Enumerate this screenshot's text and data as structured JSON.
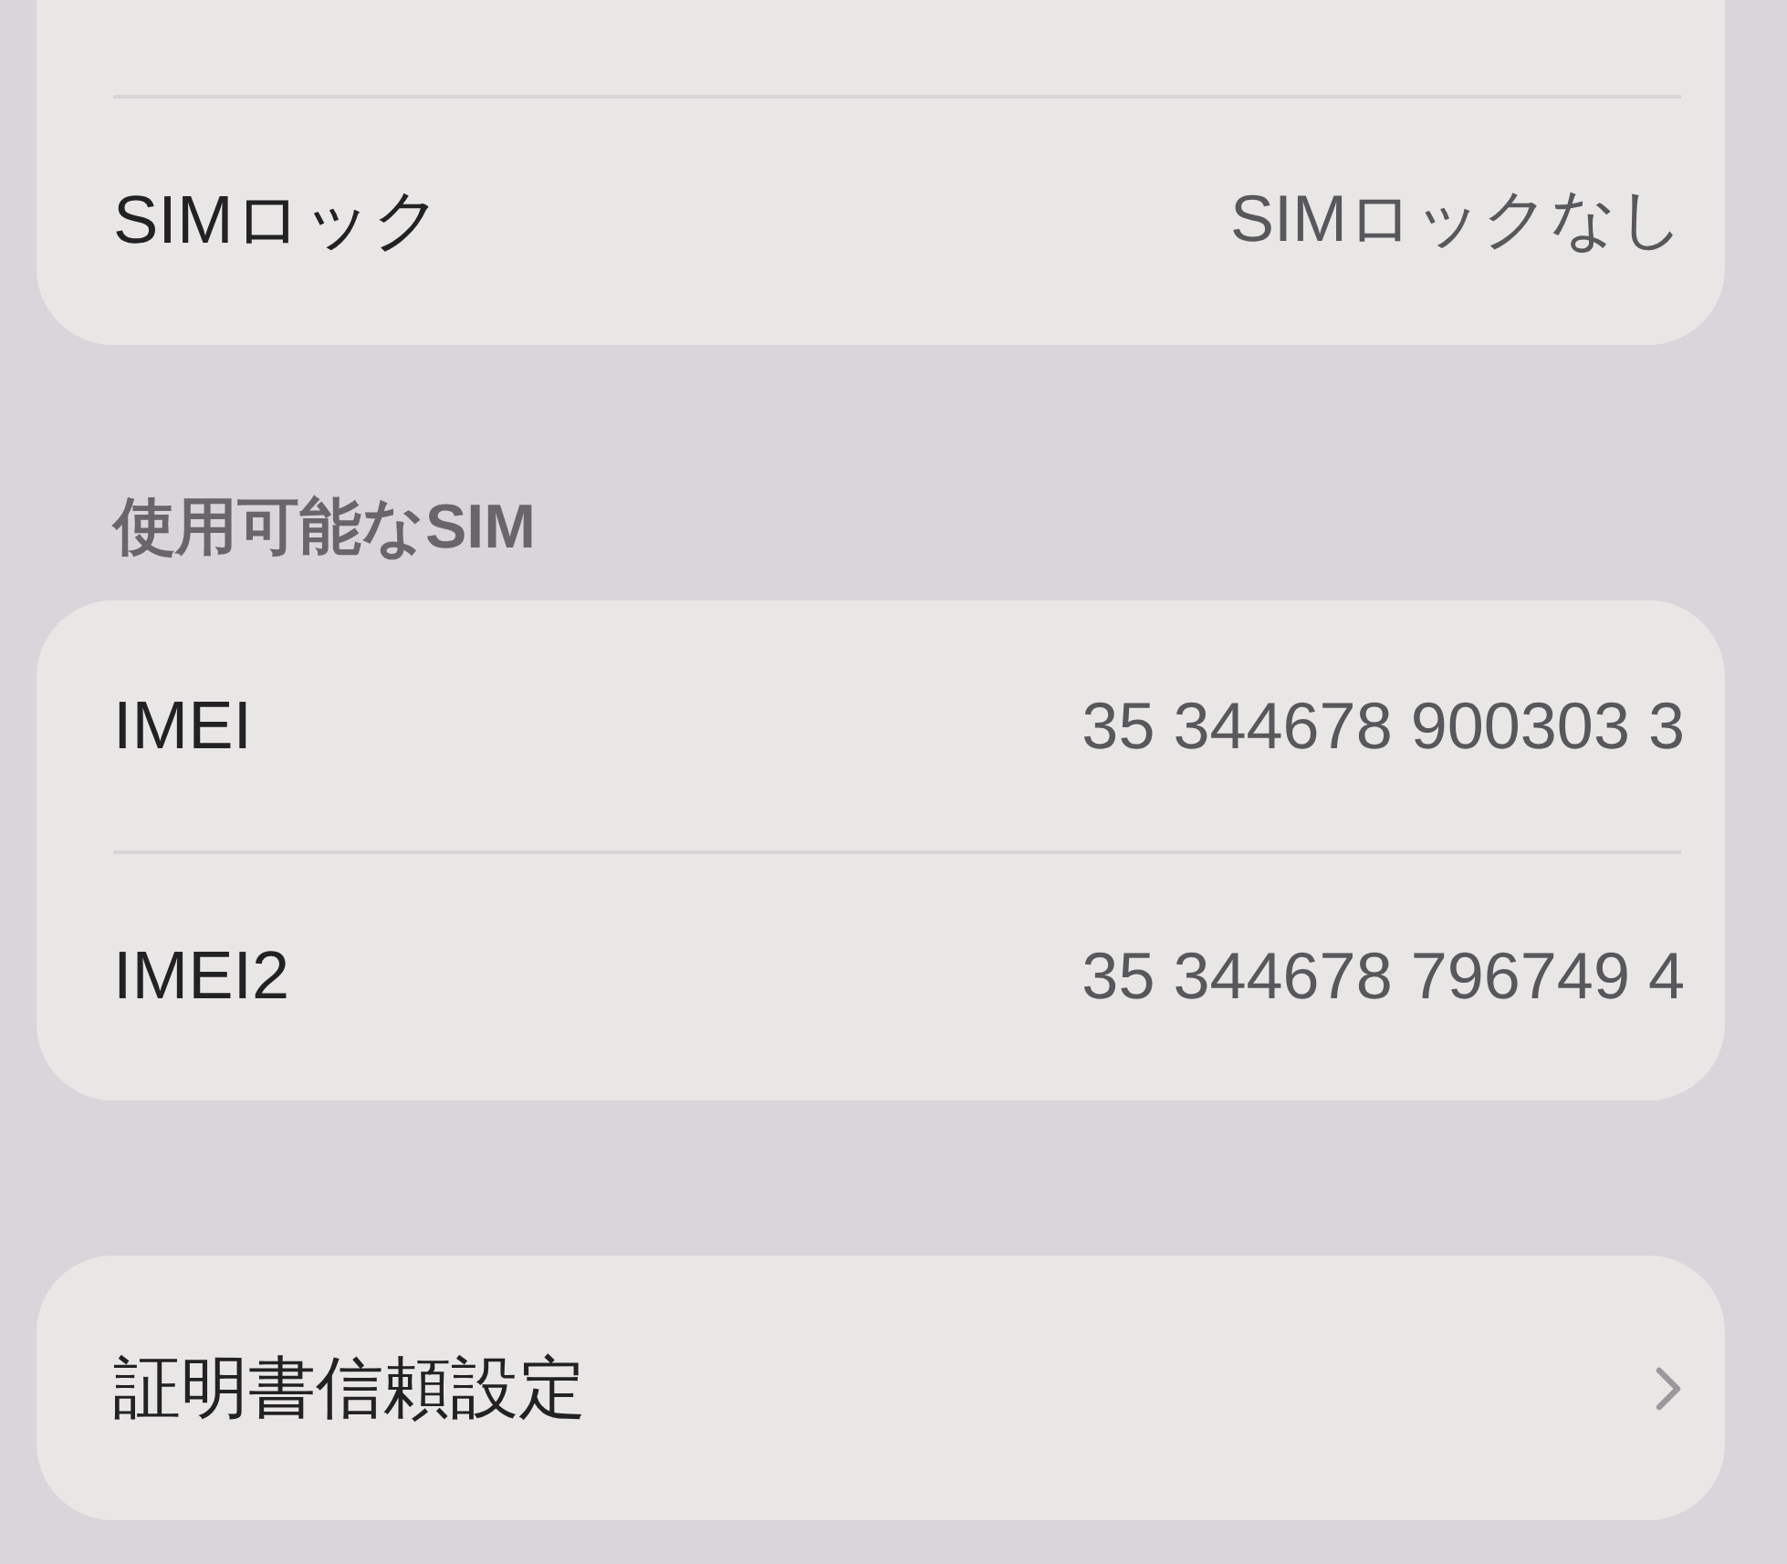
{
  "groups": [
    {
      "rows": [
        {
          "kind": "value",
          "label": "SIMロック",
          "value": "SIMロックなし"
        }
      ]
    },
    {
      "header": "使用可能なSIM",
      "rows": [
        {
          "kind": "value",
          "label": "IMEI",
          "value": "35 344678 900303 3"
        },
        {
          "kind": "value",
          "label": "IMEI2",
          "value": "35 344678 796749 4"
        }
      ]
    },
    {
      "rows": [
        {
          "kind": "disclosure",
          "label": "証明書信頼設定"
        }
      ]
    }
  ]
}
